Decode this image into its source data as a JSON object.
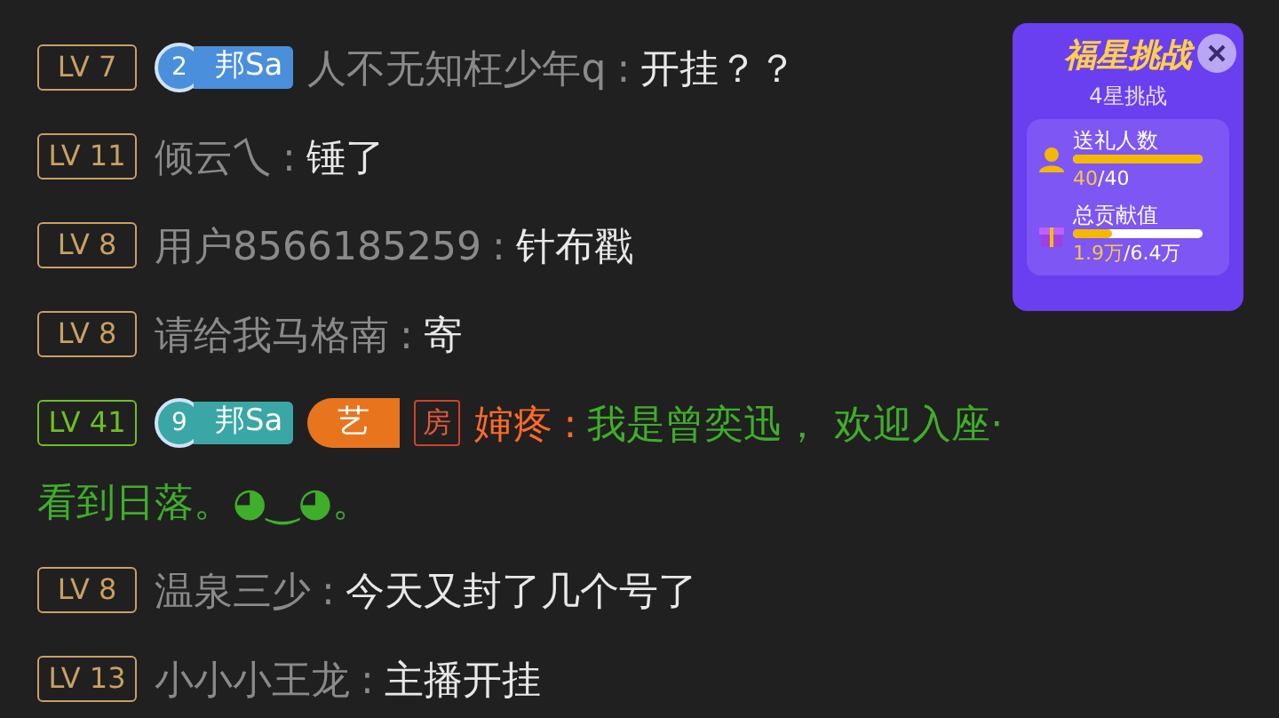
{
  "messages": [
    {
      "level": "LV 7",
      "color": "#c9a063",
      "fan_badge": {
        "number": "2",
        "name": "邦Sa",
        "color": "#4a8fdc"
      },
      "user": "人不无知枉少年q",
      "separator": ":",
      "text": "开挂？？",
      "kind": "plain"
    },
    {
      "level": "LV 11",
      "color": "#c9a063",
      "user": "倾云乀",
      "separator": ":",
      "text": "锤了",
      "kind": "plain"
    },
    {
      "level": "LV 8",
      "color": "#c9a063",
      "user": "用户8566185259",
      "separator": ":",
      "text": "针布戳",
      "kind": "plain"
    },
    {
      "level": "LV 8",
      "color": "#c9a063",
      "user": "请给我马格南",
      "separator": ":",
      "text": "寄",
      "kind": "plain"
    },
    {
      "level": "LV 41",
      "color": "#6cc022",
      "fan_badge": {
        "number": "9",
        "name": "邦Sa",
        "color": "#3aa6a6"
      },
      "noble_badge": "艺",
      "room_badge": "房",
      "user": "婶疼",
      "separator": ":",
      "text": "我是曾奕迅， 欢迎入座·",
      "continuation": "看到日落。◕‿◕。",
      "kind": "highlight"
    },
    {
      "level": "LV 8",
      "color": "#c9a063",
      "user": "温泉三少",
      "separator": ":",
      "text": "今天又封了几个号了",
      "kind": "plain"
    },
    {
      "level": "LV 13",
      "color": "#c9a063",
      "user": "小小小王龙",
      "separator": ":",
      "text": "主播开挂",
      "kind": "plain"
    }
  ],
  "challenge": {
    "title": "福星挑战",
    "subtitle": "4星挑战",
    "stats": [
      {
        "label": "送礼人数",
        "kind": "people",
        "level": 1.0,
        "current": "40",
        "total": "/40"
      },
      {
        "label": "总贡献值",
        "kind": "gift",
        "level": 0.3,
        "current": "1.9万",
        "total": "/6.4万"
      }
    ]
  }
}
